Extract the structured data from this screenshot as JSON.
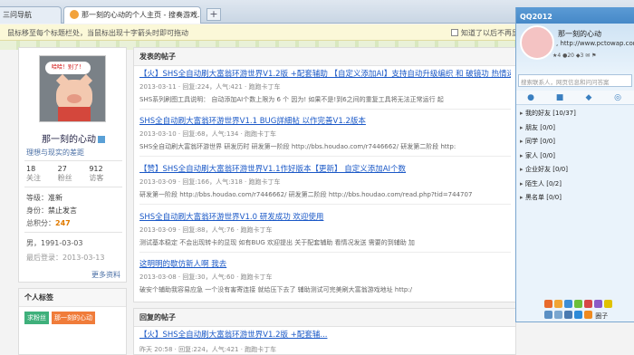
{
  "browser": {
    "tabs": [
      {
        "label": "三问导航"
      },
      {
        "label": "那一刻的心动的个人主页 - 搜奏游戏..."
      }
    ],
    "new_tab": "+"
  },
  "hint": {
    "text": "鼠标移至每个标题栏处，当鼠标出现十字箭头时即可拖动",
    "right": "知道了以后不再显示"
  },
  "profile": {
    "avatar_bubble": "哈哈！别了！",
    "name": "那一刻的心动",
    "link": "理想与现实的差距",
    "stats": [
      {
        "n": "18",
        "l": "关注"
      },
      {
        "n": "27",
        "l": "粉丝"
      },
      {
        "n": "912",
        "l": "访客"
      }
    ],
    "level_label": "等级：",
    "level_value": "准新",
    "identity_label": "身份：",
    "identity_value": "禁止发言",
    "points_label": "总积分：",
    "points_value": "247",
    "birthday": "男，1991-03-03",
    "last_visit": "最后登录：2013-03-13",
    "more": "更多资料"
  },
  "tags": {
    "title": "个人标签",
    "items": [
      "求粉丝",
      "那一刻的心动"
    ]
  },
  "posts_header": "发表的帖子",
  "posts": [
    {
      "title": "【火】SHS全自动刷大富翁环游世界V1.2版 +配套辅助 【自定义添加AI】支持自动升级编织 和 破镜功 热情运送",
      "info": "2013-03-11 · 回复:224，人气:421 · 跑跑卡丁车",
      "excerpt": "SHS系列刷图工具说明： 自动添加AI个数上限为 6 个 因为! 如果不是!到6之间的重复工具将无法正常运行 起"
    },
    {
      "title": "SHS全自动刷大富翁环游世界V1.1 BUG詳細帖 以作完善V1.2版本",
      "info": "2013-03-10 · 回复:68，人气:134 · 跑跑卡丁车",
      "excerpt": "SHS全自动刷大富翁环游世界 研发历时 研发第一阶段 http://bbs.houdao.com/r7446662/ 研发第二阶段 http:"
    },
    {
      "title": "【赞】SHS全自动刷大富翁环游世界V1.1作好版本【更新】 自定义添加AI个数",
      "info": "2013-03-09 · 回复:166，人气:318 · 跑跑卡丁车",
      "excerpt": "研发第一阶段 http://bbs.houdao.com/r7446662/ 研发第二阶段 http://bbs.houdao.com/read.php?tid=744707"
    },
    {
      "title": "SHS全自动刷大富翁环游世界V1.0 研发成功 欢迎使用",
      "info": "2013-03-09 · 回复:88，人气:76 · 跑跑卡丁车",
      "excerpt": "测试基本稳定 不会出现转卡的显现 如有BUG 欢迎提出 关于配套辅助 看情况发送 需要的到辅助 加"
    },
    {
      "title": "这明明的歇仿新人啊 我去",
      "info": "2013-03-08 · 回复:30，人气:60 · 跑跑卡丁车",
      "excerpt": "破安个辅助我容易应急 一个没有害寄连接 就给压下去了 辅助测试可完美刷大富翁游戏地址 http:/"
    }
  ],
  "replies_header": "回复的帖子",
  "reply": {
    "title": "【火】SHS全自动刷大富翁环游世界V1.2版 +配套辅...",
    "info": "昨天 20:58 · 回复:224，人气:421 · 跑跑卡丁车"
  },
  "qq": {
    "title": "QQ2012",
    "name": "那一刻的心动",
    "signature": ", http://www.pctowap.com",
    "status_row": "★4 ●20 ◆3 ✉ ⚑",
    "search_placeholder": "搜索联系人，网页信息和问问答案",
    "tabs": [
      "●",
      "■",
      "◆",
      "◎"
    ],
    "groups": [
      {
        "name": "我的好友",
        "count": "[10/37]"
      },
      {
        "name": "朋友",
        "count": "[0/0]"
      },
      {
        "name": "同学",
        "count": "[0/0]"
      },
      {
        "name": "家人",
        "count": "[0/0]"
      },
      {
        "name": "企业好友",
        "count": "[0/0]"
      },
      {
        "name": "陌生人",
        "count": "[0/2]"
      },
      {
        "name": "黑名单",
        "count": "[0/0]"
      }
    ],
    "bottom_label": "圈子"
  }
}
